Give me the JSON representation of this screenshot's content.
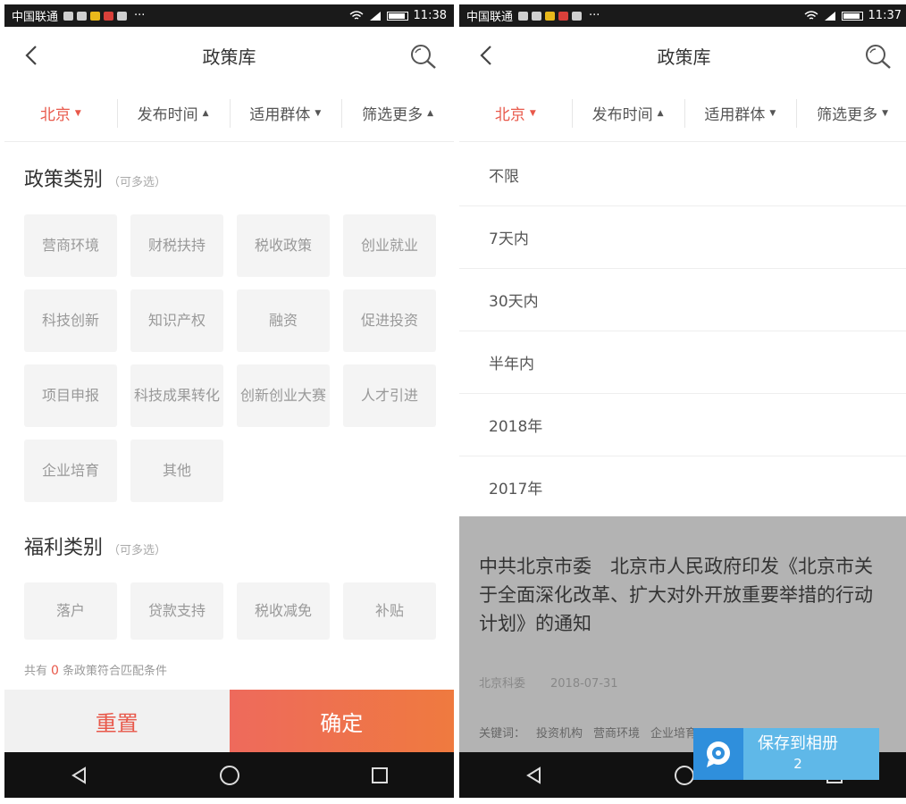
{
  "left": {
    "status": {
      "carrier": "中国联通",
      "time": "11:38",
      "dots": "···"
    },
    "nav": {
      "title": "政策库"
    },
    "filters": [
      {
        "label": "北京",
        "arrow": "▼"
      },
      {
        "label": "发布时间",
        "arrow": "▲"
      },
      {
        "label": "适用群体",
        "arrow": "▼"
      },
      {
        "label": "筛选更多",
        "arrow": "▲"
      }
    ],
    "policy_section": {
      "title": "政策类别",
      "hint": "（可多选）"
    },
    "policy_tags": [
      "营商环境",
      "财税扶持",
      "税收政策",
      "创业就业",
      "科技创新",
      "知识产权",
      "融资",
      "促进投资",
      "项目申报",
      "科技成果转化",
      "创新创业大赛",
      "人才引进",
      "企业培育",
      "其他"
    ],
    "welfare_section": {
      "title": "福利类别",
      "hint": "（可多选）"
    },
    "welfare_tags": [
      "落户",
      "贷款支持",
      "税收减免",
      "补贴"
    ],
    "count": {
      "prefix": "共有",
      "number": "0",
      "suffix": "条政策符合匹配条件"
    },
    "buttons": {
      "reset": "重置",
      "confirm": "确定"
    }
  },
  "right": {
    "status": {
      "carrier": "中国联通",
      "time": "11:37",
      "dots": "···"
    },
    "nav": {
      "title": "政策库"
    },
    "filters": [
      {
        "label": "北京",
        "arrow": "▼"
      },
      {
        "label": "发布时间",
        "arrow": "▲"
      },
      {
        "label": "适用群体",
        "arrow": "▼"
      },
      {
        "label": "筛选更多",
        "arrow": "▼"
      }
    ],
    "time_options": [
      "不限",
      "7天内",
      "30天内",
      "半年内",
      "2018年",
      "2017年"
    ],
    "article": {
      "title": "中共北京市委　北京市人民政府印发《北京市关于全面深化改革、扩大对外开放重要举措的行动计划》的通知",
      "source": "北京科委",
      "date": "2018-07-31",
      "keywords_label": "关键词：",
      "keywords": [
        "投资机构",
        "营商环境",
        "企业培育"
      ]
    },
    "save_popup": {
      "label": "保存到相册",
      "page": "2"
    }
  },
  "colors": {
    "accent": "#e8584a",
    "confirm_gradient_end": "#ef7a3f",
    "tag_bg": "#f4f4f4",
    "popup": "#5fb8e8"
  },
  "icons": [
    "back-icon",
    "search-icon",
    "nav-back-icon",
    "nav-home-icon",
    "nav-recent-icon",
    "app-logo-icon"
  ]
}
